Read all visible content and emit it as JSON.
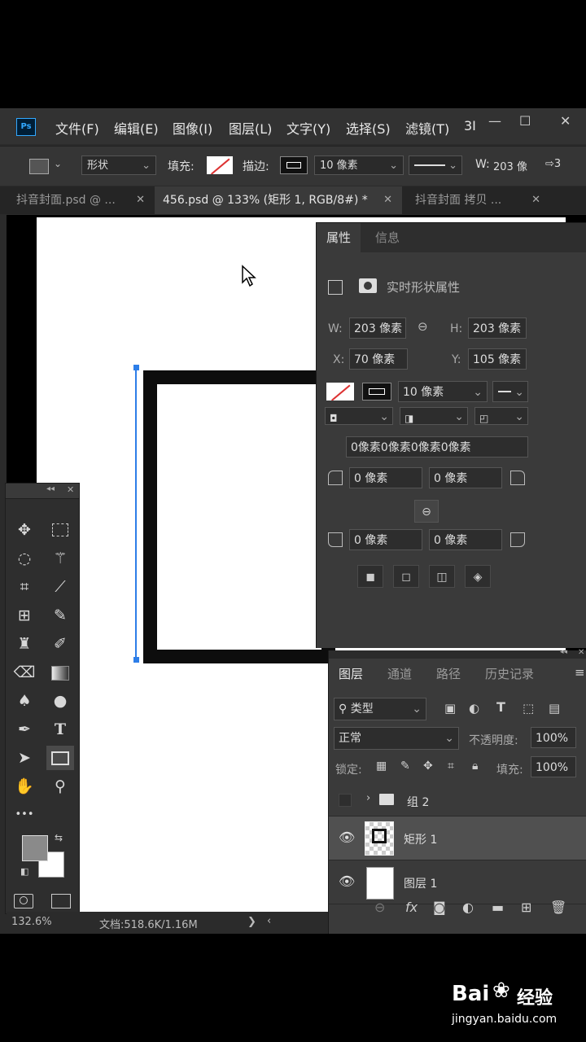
{
  "app": {
    "logo": "Ps",
    "menu": [
      "文件(F)",
      "编辑(E)",
      "图像(I)",
      "图层(L)",
      "文字(Y)",
      "选择(S)",
      "滤镜(T)",
      "3I"
    ],
    "window_controls": [
      "—",
      "☐",
      "✕"
    ]
  },
  "options_bar": {
    "mode": "形状",
    "fill_label": "填充:",
    "stroke_label": "描边:",
    "stroke_width": "10 像素",
    "width_label": "W:",
    "width_value": "203 像",
    "extra": "⇨3"
  },
  "tabs": [
    {
      "label": "抖音封面.psd @ ...",
      "close": "✕",
      "active": false
    },
    {
      "label": "456.psd @ 133% (矩形 1, RGB/8#) *",
      "close": "✕",
      "active": true
    },
    {
      "label": "抖音封面 拷贝 ...",
      "close": "✕",
      "active": false
    }
  ],
  "status": {
    "zoom": "132.6%",
    "doc_info": "文档:518.6K/1.16M",
    "arrow_right": "❯",
    "arrow_left": "‹"
  },
  "properties": {
    "tab_active": "属性",
    "tab_other": "信息",
    "title": "实时形状属性",
    "w_label": "W:",
    "w_value": "203 像素",
    "h_label": "H:",
    "h_value": "203 像素",
    "x_label": "X:",
    "x_value": "70 像素",
    "y_label": "Y:",
    "y_value": "105 像素",
    "stroke_width": "10 像素",
    "corners_all": "0像素0像素0像素0像素",
    "corner_tl": "0 像素",
    "corner_tr": "0 像素",
    "corner_bl": "0 像素",
    "corner_br": "0 像素"
  },
  "layers": {
    "tabs": [
      "图层",
      "通道",
      "路径",
      "历史记录"
    ],
    "menu_icon": "≡",
    "filter": "类型",
    "blend_mode": "正常",
    "opacity_label": "不透明度:",
    "opacity_value": "100%",
    "lock_label": "锁定:",
    "fill_label": "填充:",
    "fill_value": "100%",
    "items": [
      {
        "name": "组 2",
        "visible": false,
        "type": "group"
      },
      {
        "name": "矩形 1",
        "visible": true,
        "type": "shape",
        "selected": true
      },
      {
        "name": "图层 1",
        "visible": true,
        "type": "pixel"
      }
    ],
    "footer_fx": "fx"
  },
  "toolbox": {
    "collapse": "◂◂",
    "close": "✕",
    "type_tool": "T",
    "more": "•••"
  },
  "watermark": {
    "brand": "Bai",
    "brand2": "经验",
    "url": "jingyan.baidu.com"
  }
}
